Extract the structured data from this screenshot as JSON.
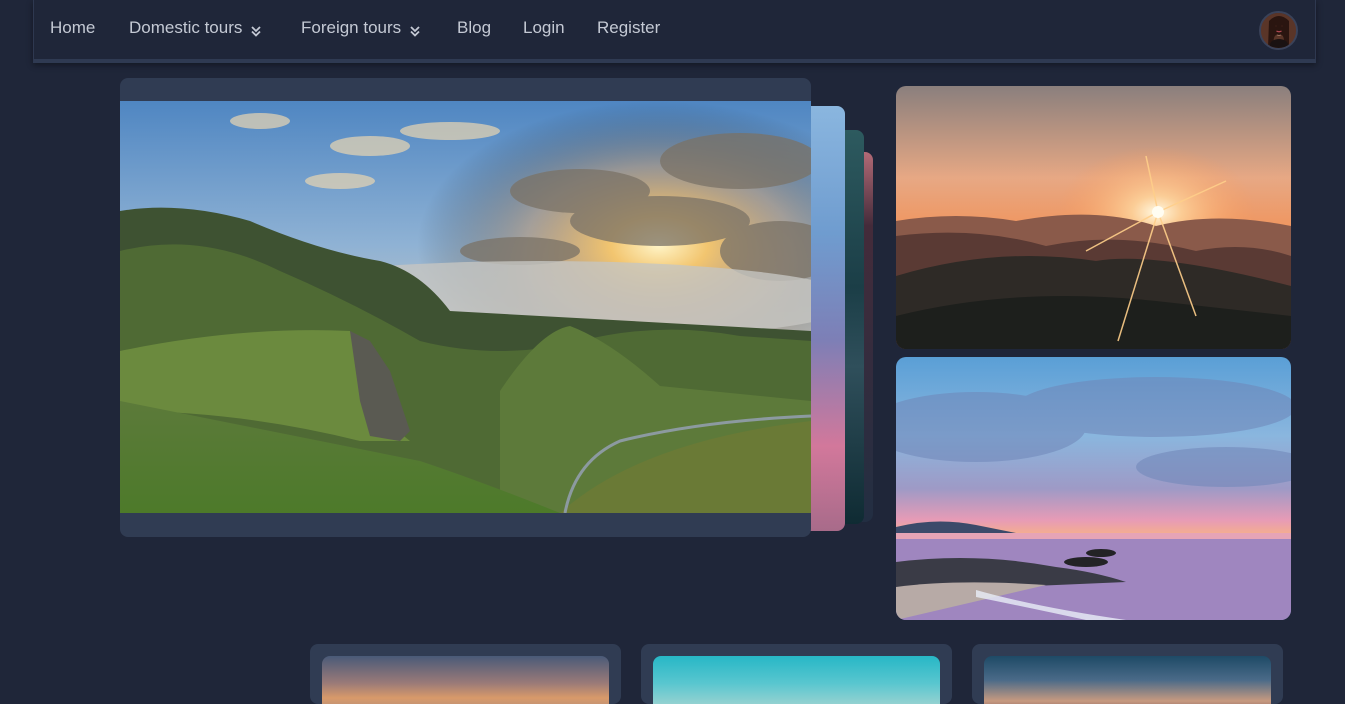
{
  "nav": {
    "items": [
      {
        "label": "Home",
        "has_dropdown": false
      },
      {
        "label": "Domestic tours",
        "has_dropdown": true
      },
      {
        "label": "Foreign tours",
        "has_dropdown": true
      },
      {
        "label": "Blog",
        "has_dropdown": false
      },
      {
        "label": "Login",
        "has_dropdown": false
      },
      {
        "label": "Register",
        "has_dropdown": false
      }
    ],
    "dropdown_icon": "double-chevron-down-icon",
    "avatar_icon": "user-avatar"
  },
  "colors": {
    "background": "#1f2639",
    "card": "#303c53",
    "nav_text": "#c4c9d4"
  },
  "images": {
    "hero": "mountain-valley-landscape",
    "stack": [
      "purple-sunset-beach",
      "teal-ocean",
      "pink-sunset"
    ],
    "side": [
      "mountain-sunset-sunburst",
      "pink-sunset-beach"
    ],
    "bottom": [
      "sunset-sky",
      "turquoise-sky",
      "dramatic-clouds-sunset"
    ]
  }
}
